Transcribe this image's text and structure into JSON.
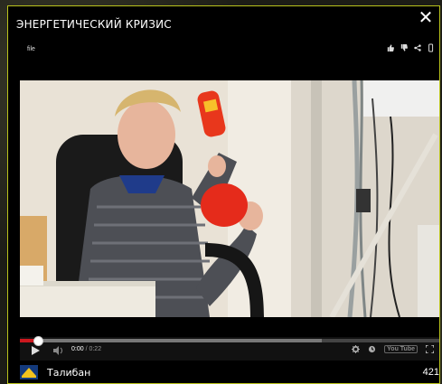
{
  "modal": {
    "title": "ЭНЕРГЕТИЧЕСКИЙ КРИЗИС",
    "close_symbol": "✕",
    "subtitle": "file"
  },
  "top_actions": [
    "thumbs-up-icon",
    "thumbs-down-icon",
    "share-icon",
    "more-icon"
  ],
  "player": {
    "current_time": "0:00",
    "separator": " / ",
    "duration": "0:22",
    "progress_fraction": 0.04,
    "buffered_fraction": 0.72,
    "youtube_label": "You Tube",
    "accent_color": "#cc181e"
  },
  "channel": {
    "name": "Талибан",
    "count": "421"
  },
  "colors": {
    "frame_border": "#b9c21c",
    "background": "#000000"
  }
}
